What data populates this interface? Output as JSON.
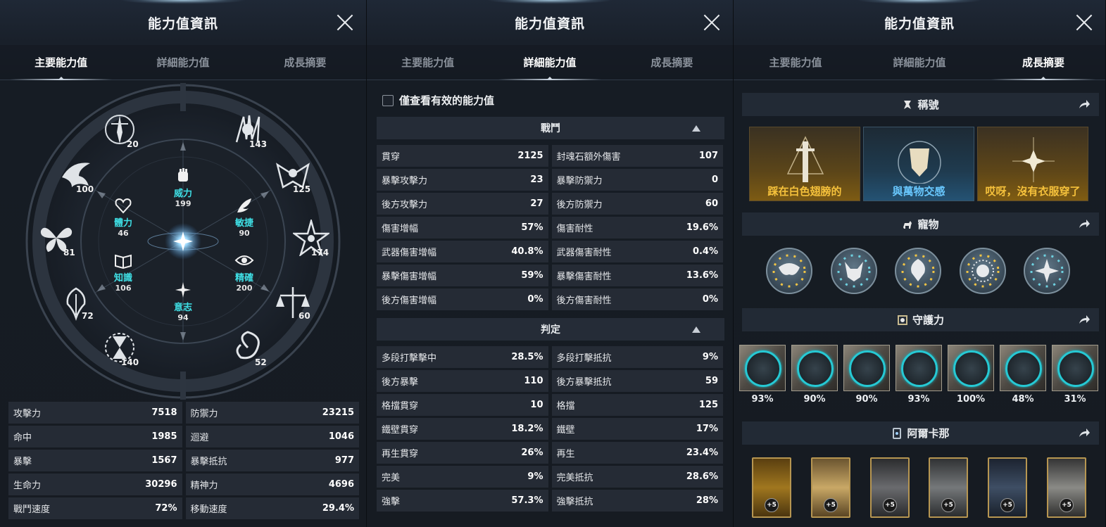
{
  "panels": [
    {
      "title": "能力值資訊",
      "tabs": [
        "主要能力值",
        "詳細能力值",
        "成長摘要"
      ],
      "active_tab": 0
    },
    {
      "title": "能力值資訊",
      "tabs": [
        "主要能力值",
        "詳細能力值",
        "成長摘要"
      ],
      "active_tab": 1
    },
    {
      "title": "能力值資訊",
      "tabs": [
        "主要能力值",
        "詳細能力值",
        "成長摘要"
      ],
      "active_tab": 2
    }
  ],
  "wheel": {
    "outer_values": [
      "20",
      "143",
      "100",
      "125",
      "81",
      "174",
      "72",
      "60",
      "140",
      "52"
    ],
    "core": [
      {
        "name": "威力",
        "value": "199"
      },
      {
        "name": "體力",
        "value": "46"
      },
      {
        "name": "敏捷",
        "value": "90"
      },
      {
        "name": "知識",
        "value": "106"
      },
      {
        "name": "精確",
        "value": "200"
      },
      {
        "name": "意志",
        "value": "94"
      }
    ]
  },
  "main_stats": [
    {
      "label": "攻擊力",
      "value": "7518"
    },
    {
      "label": "防禦力",
      "value": "23215"
    },
    {
      "label": "命中",
      "value": "1985"
    },
    {
      "label": "迴避",
      "value": "1046"
    },
    {
      "label": "暴擊",
      "value": "1567"
    },
    {
      "label": "暴擊抵抗",
      "value": "977"
    },
    {
      "label": "生命力",
      "value": "30296"
    },
    {
      "label": "精神力",
      "value": "4696"
    },
    {
      "label": "戰鬥速度",
      "value": "72%"
    },
    {
      "label": "移動速度",
      "value": "29.4%"
    }
  ],
  "detail": {
    "checkbox_label": "僅查看有效的能力值",
    "combat_title": "戰鬥",
    "combat": [
      {
        "label": "貫穿",
        "value": "2125"
      },
      {
        "label": "封魂石額外傷害",
        "value": "107"
      },
      {
        "label": "暴擊攻擊力",
        "value": "23"
      },
      {
        "label": "暴擊防禦力",
        "value": "0"
      },
      {
        "label": "後方攻擊力",
        "value": "27"
      },
      {
        "label": "後方防禦力",
        "value": "60"
      },
      {
        "label": "傷害增幅",
        "value": "57%"
      },
      {
        "label": "傷害耐性",
        "value": "19.6%"
      },
      {
        "label": "武器傷害增幅",
        "value": "40.8%"
      },
      {
        "label": "武器傷害耐性",
        "value": "0.4%"
      },
      {
        "label": "暴擊傷害增幅",
        "value": "59%"
      },
      {
        "label": "暴擊傷害耐性",
        "value": "13.6%"
      },
      {
        "label": "後方傷害增幅",
        "value": "0%"
      },
      {
        "label": "後方傷害耐性",
        "value": "0%"
      }
    ],
    "judge_title": "判定",
    "judge": [
      {
        "label": "多段打擊擊中",
        "value": "28.5%"
      },
      {
        "label": "多段打擊抵抗",
        "value": "9%"
      },
      {
        "label": "後方暴擊",
        "value": "110"
      },
      {
        "label": "後方暴擊抵抗",
        "value": "59"
      },
      {
        "label": "格擋貫穿",
        "value": "10"
      },
      {
        "label": "格擋",
        "value": "125"
      },
      {
        "label": "鐵壁貫穿",
        "value": "18.2%"
      },
      {
        "label": "鐵壁",
        "value": "17%"
      },
      {
        "label": "再生貫穿",
        "value": "26%"
      },
      {
        "label": "再生",
        "value": "23.4%"
      },
      {
        "label": "完美",
        "value": "9%"
      },
      {
        "label": "完美抵抗",
        "value": "28.6%"
      },
      {
        "label": "強擊",
        "value": "57.3%"
      },
      {
        "label": "強擊抵抗",
        "value": "28%"
      }
    ]
  },
  "growth": {
    "titles_header": "稱號",
    "titles": [
      "踩在白色翅膀的",
      "與萬物交感",
      "哎呀，沒有衣服穿了"
    ],
    "pets_header": "寵物",
    "guardian_header": "守護力",
    "guardians": [
      "93%",
      "90%",
      "90%",
      "93%",
      "100%",
      "48%",
      "31%"
    ],
    "arcana_header": "阿爾卡那",
    "arcana": [
      "+5",
      "+5",
      "+5",
      "+5",
      "+5",
      "+5"
    ]
  },
  "colors": {
    "accent_cyan": "#3fe0e6",
    "gold": "#f5c13b",
    "blue_title": "#69c8ff",
    "guard_ring": "#26c9d4"
  }
}
